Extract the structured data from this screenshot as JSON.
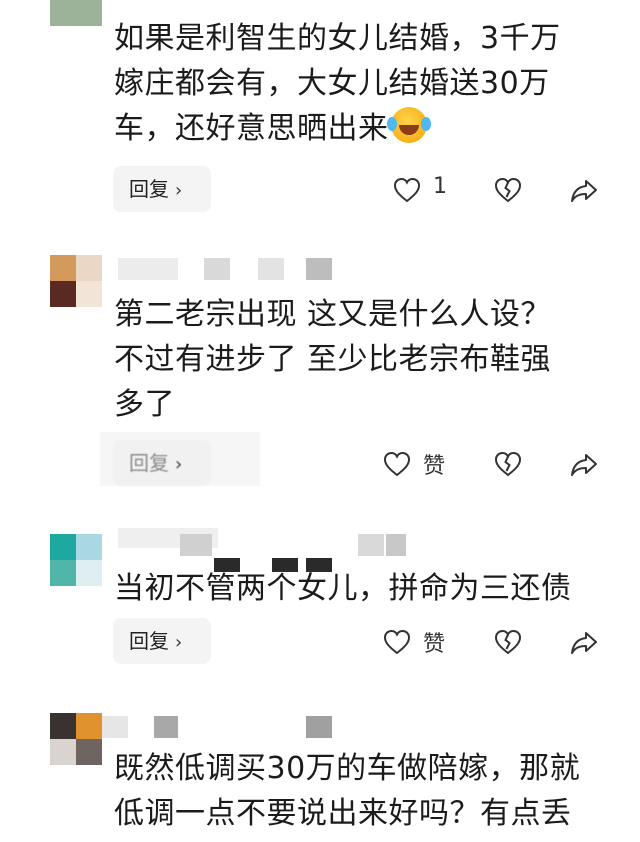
{
  "comments": [
    {
      "username": "",
      "text_lines": [
        "如果是利智生的女儿结婚，3千万",
        "嫁庄都会有，大女儿结婚送30万",
        "车，还好意思晒出来"
      ],
      "emoji": "face-with-tears-of-joy",
      "reply_label": "回复",
      "like_count": "1"
    },
    {
      "text_lines": [
        "第二老宗出现 这又是什么人设？",
        "不过有进步了 至少比老宗布鞋强",
        "多了"
      ],
      "reply_label": "回复",
      "like_label": "赞"
    },
    {
      "text_lines": [
        "当初不管两个女儿，拼命为三还债"
      ],
      "reply_label": "回复",
      "like_label": "赞"
    },
    {
      "text_lines": [
        "既然低调买30万的车做陪嫁，那就",
        "低调一点不要说出来好吗？有点丢"
      ]
    }
  ],
  "colors": {
    "text": "#1b1b1b",
    "reply_bg": "#f4f4f4",
    "icon": "#333333",
    "pixelation": "#d9d9d9"
  },
  "icons": [
    "heart-icon",
    "broken-heart-icon",
    "share-arrow-icon"
  ]
}
